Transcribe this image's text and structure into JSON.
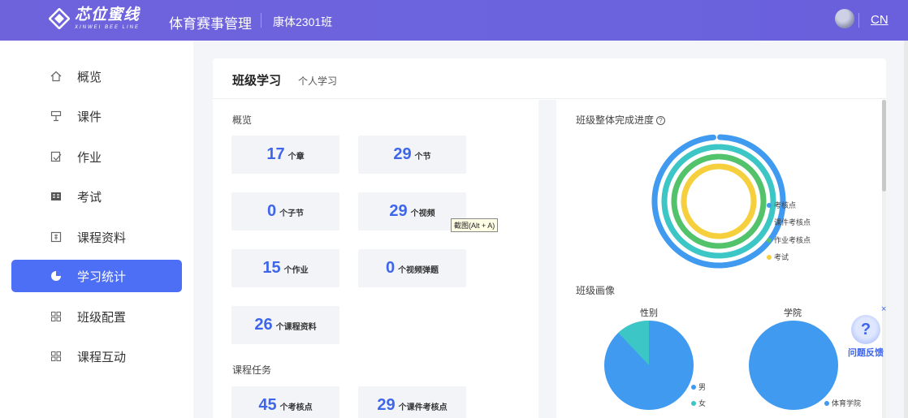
{
  "header": {
    "logo_cn": "芯位蜜线",
    "logo_en": "XINWEI BEE LINE",
    "app_title": "体育赛事管理",
    "class_name": "康体2301班",
    "lang": "CN"
  },
  "sidebar": {
    "items": [
      {
        "label": "概览",
        "icon": "home-icon"
      },
      {
        "label": "课件",
        "icon": "courseware-icon"
      },
      {
        "label": "作业",
        "icon": "assignment-icon"
      },
      {
        "label": "考试",
        "icon": "exam-icon"
      },
      {
        "label": "课程资料",
        "icon": "materials-icon"
      },
      {
        "label": "学习统计",
        "icon": "pie-chart-icon",
        "active": true
      },
      {
        "label": "班级配置",
        "icon": "grid-icon"
      },
      {
        "label": "课程互动",
        "icon": "grid-icon"
      }
    ]
  },
  "tabs": {
    "active": "班级学习",
    "other": "个人学习"
  },
  "overview": {
    "title": "概览",
    "stats": [
      {
        "value": "17",
        "unit": "个章"
      },
      {
        "value": "29",
        "unit": "个节"
      },
      {
        "value": "0",
        "unit": "个子节"
      },
      {
        "value": "29",
        "unit": "个视频"
      },
      {
        "value": "15",
        "unit": "个作业"
      },
      {
        "value": "0",
        "unit": "个视频弹题"
      },
      {
        "value": "26",
        "unit": "个课程资料"
      }
    ]
  },
  "tasks": {
    "title": "课程任务",
    "stats": [
      {
        "value": "45",
        "unit": "个考核点"
      },
      {
        "value": "29",
        "unit": "个课件考核点"
      }
    ]
  },
  "tooltip": "截图(Alt + A)",
  "progress": {
    "title": "班级整体完成进度",
    "help": "?",
    "legend": [
      {
        "label": "考核点",
        "color": "#3f9af0"
      },
      {
        "label": "课件考核点",
        "color": "#3cc6c6"
      },
      {
        "label": "作业考核点",
        "color": "#52c26b"
      },
      {
        "label": "考试",
        "color": "#f5cf3c"
      }
    ],
    "rings_completion": [
      0.99,
      1.0,
      1.0,
      1.0
    ]
  },
  "portrait": {
    "title": "班级画像",
    "gender": {
      "title": "性别",
      "legend": [
        {
          "label": "男",
          "color": "#3f9af0"
        },
        {
          "label": "女",
          "color": "#3cc6c6"
        }
      ],
      "female_share": 0.12
    },
    "college": {
      "title": "学院",
      "legend": [
        {
          "label": "体育学院",
          "color": "#3f9af0"
        }
      ]
    }
  },
  "feedback": {
    "label": "问题反馈",
    "close": "×",
    "icon": "?"
  }
}
